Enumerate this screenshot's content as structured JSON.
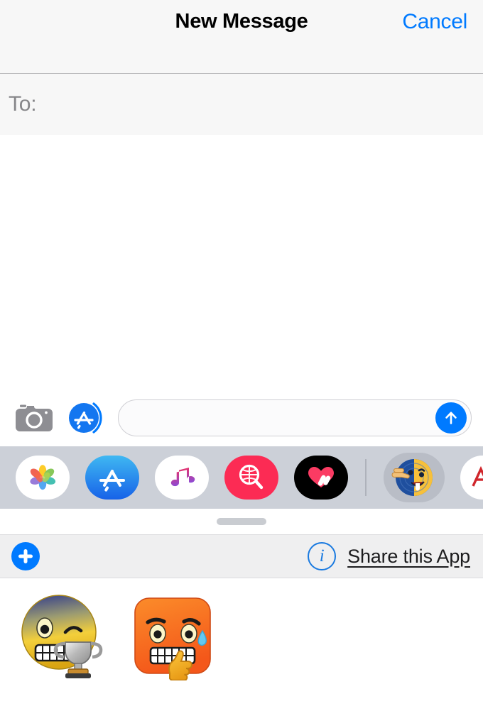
{
  "navbar": {
    "title": "New Message",
    "cancel_label": "Cancel",
    "accent_color": "#007aff"
  },
  "recipient_field": {
    "label": "To:",
    "value": "",
    "placeholder": ""
  },
  "compose_bar": {
    "camera_icon": "camera-icon",
    "appstore_icon": "app-store-icon",
    "input_value": "",
    "input_placeholder": "",
    "send_icon": "arrow-up-icon",
    "send_color": "#007aff"
  },
  "app_drawer": {
    "apps": [
      {
        "name": "photos",
        "label": "Photos",
        "selected": false
      },
      {
        "name": "app-store",
        "label": "App Store",
        "selected": false
      },
      {
        "name": "music",
        "label": "Music",
        "selected": false
      },
      {
        "name": "images",
        "label": "#images",
        "selected": false
      },
      {
        "name": "digital-touch",
        "label": "Digital Touch",
        "selected": false
      },
      {
        "name": "emoji-stickers",
        "label": "Emoji Stickers",
        "selected": true
      },
      {
        "name": "ad-app",
        "label": "AD",
        "selected": false
      }
    ]
  },
  "drag_handle": {
    "name": "drawer-drag-handle",
    "color": "#c9ccd1"
  },
  "app_toolbar": {
    "add_label": "+",
    "info_label": "i",
    "share_label": "Share this App",
    "accent_color": "#007aff"
  },
  "sticker_panel": {
    "stickers": [
      {
        "name": "trophy-grin-emoji-sticker",
        "label": "Winking grin with trophy"
      },
      {
        "name": "sweating-grimace-square-emoji-sticker",
        "label": "Sweating grimace with thumbs up"
      }
    ]
  }
}
